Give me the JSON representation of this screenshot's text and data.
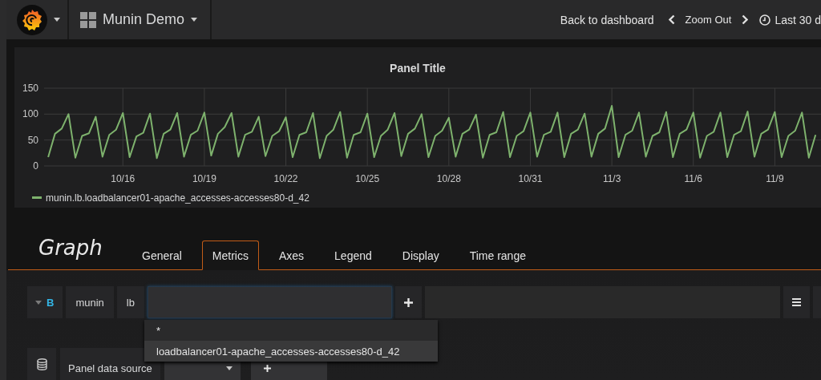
{
  "navbar": {
    "dashboard_title": "Munin Demo",
    "actions": [
      {
        "kind": "link",
        "label": "Back to dashboard"
      },
      {
        "kind": "zoom",
        "label": "Zoom Out"
      },
      {
        "kind": "time",
        "label": "Last 30 d"
      }
    ]
  },
  "panel": {
    "title": "Panel Title",
    "chart_data": {
      "type": "line",
      "grid": true,
      "ylim": [
        0,
        150
      ],
      "yticks": [
        0,
        50,
        100,
        150
      ],
      "categories": [
        null,
        null,
        null,
        null,
        null,
        null,
        null,
        null,
        null,
        null,
        null,
        "10/16",
        null,
        null,
        null,
        null,
        null,
        null,
        null,
        null,
        null,
        null,
        null,
        "10/19",
        null,
        null,
        null,
        null,
        null,
        null,
        null,
        null,
        null,
        null,
        null,
        "10/22",
        null,
        null,
        null,
        null,
        null,
        null,
        null,
        null,
        null,
        null,
        null,
        "10/25",
        null,
        null,
        null,
        null,
        null,
        null,
        null,
        null,
        null,
        null,
        null,
        "10/28",
        null,
        null,
        null,
        null,
        null,
        null,
        null,
        null,
        null,
        null,
        null,
        "10/31",
        null,
        null,
        null,
        null,
        null,
        null,
        null,
        null,
        null,
        null,
        null,
        "11/3",
        null,
        null,
        null,
        null,
        null,
        null,
        null,
        null,
        null,
        null,
        null,
        "11/6",
        null,
        null,
        null,
        null,
        null,
        null,
        null,
        null,
        null,
        null,
        null,
        "11/9",
        null,
        null,
        null,
        null,
        null,
        null
      ],
      "series": [
        {
          "name": "munin.lb.loadbalancer01-apache_accesses-accesses80-d_42",
          "color": "#7eb26d",
          "values": [
            17,
            62,
            72,
            100,
            16,
            58,
            63,
            95,
            18,
            60,
            70,
            102,
            17,
            57,
            64,
            101,
            15,
            62,
            70,
            102,
            18,
            60,
            68,
            103,
            20,
            62,
            75,
            102,
            18,
            60,
            66,
            95,
            19,
            58,
            67,
            94,
            17,
            60,
            65,
            102,
            15,
            58,
            70,
            104,
            16,
            60,
            65,
            101,
            17,
            58,
            70,
            102,
            19,
            62,
            72,
            100,
            17,
            58,
            68,
            93,
            18,
            62,
            70,
            99,
            16,
            60,
            65,
            104,
            17,
            58,
            67,
            103,
            18,
            60,
            66,
            103,
            17,
            62,
            70,
            101,
            18,
            62,
            72,
            116,
            17,
            60,
            68,
            103,
            18,
            58,
            65,
            104,
            17,
            62,
            70,
            103,
            16,
            58,
            66,
            103,
            17,
            60,
            67,
            105,
            18,
            62,
            70,
            104,
            17,
            58,
            68,
            103,
            16,
            60
          ]
        }
      ]
    }
  },
  "editor": {
    "title": "Graph",
    "tabs": [
      {
        "label": "General",
        "selected": false
      },
      {
        "label": "Metrics",
        "selected": true
      },
      {
        "label": "Axes",
        "selected": false
      },
      {
        "label": "Legend",
        "selected": false
      },
      {
        "label": "Display",
        "selected": false
      },
      {
        "label": "Time range",
        "selected": false
      }
    ],
    "query": {
      "ref_id": "B",
      "segments": [
        "munin",
        "lb"
      ],
      "suggestions": [
        {
          "label": "*",
          "selected": false
        },
        {
          "label": "loadbalancer01-apache_accesses-accesses80-d_42",
          "selected": true
        }
      ]
    },
    "data_source": {
      "label": "Panel data source"
    }
  }
}
